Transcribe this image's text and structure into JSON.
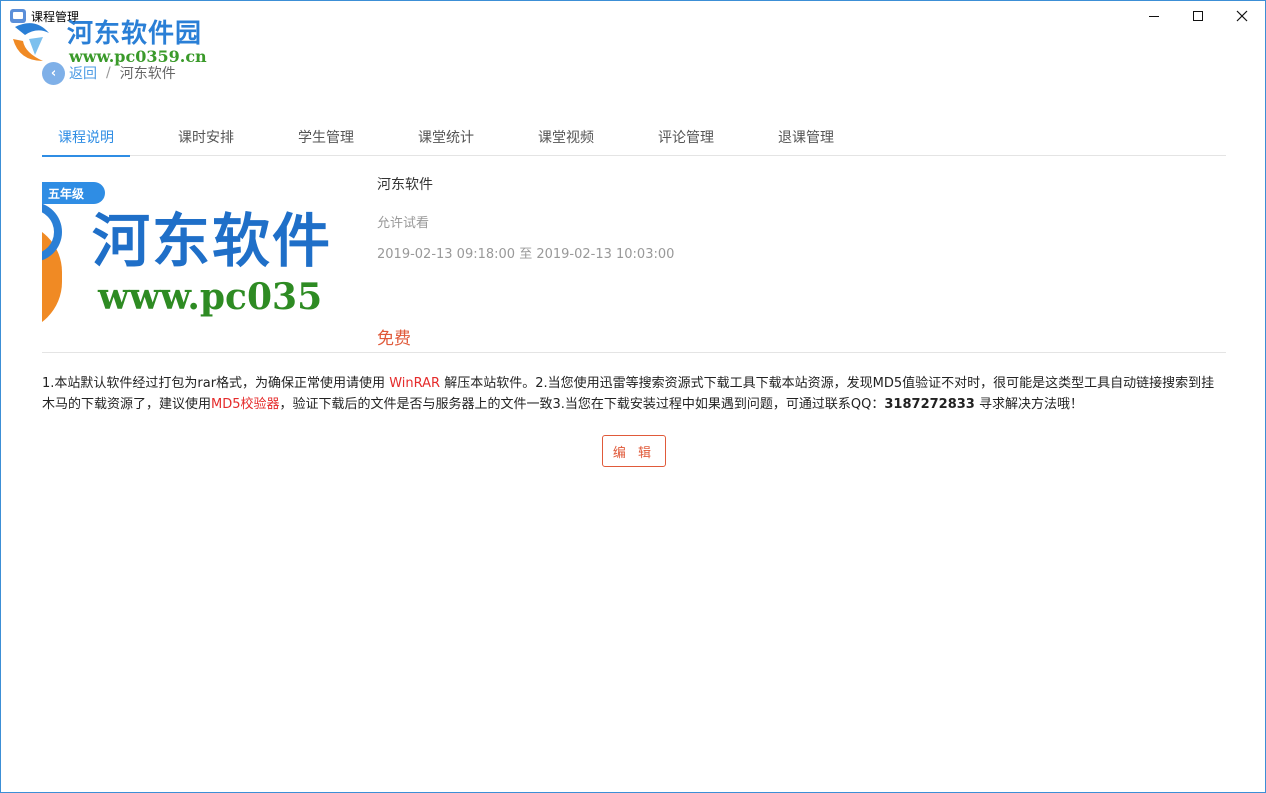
{
  "window": {
    "title": "课程管理",
    "controls": {
      "minimize_icon": "minimize-icon",
      "maximize_icon": "maximize-icon",
      "close_icon": "close-icon"
    }
  },
  "watermark": {
    "name": "河东软件园",
    "url": "www.pc0359.cn"
  },
  "breadcrumb": {
    "back_label": "返回",
    "separator": "/",
    "current": "河东软件"
  },
  "tabs": [
    {
      "label": "课程说明",
      "active": true
    },
    {
      "label": "课时安排",
      "active": false
    },
    {
      "label": "学生管理",
      "active": false
    },
    {
      "label": "课堂统计",
      "active": false
    },
    {
      "label": "课堂视频",
      "active": false
    },
    {
      "label": "评论管理",
      "active": false
    },
    {
      "label": "退课管理",
      "active": false
    }
  ],
  "course": {
    "grade_badge": "五年级",
    "cover_text": "河东软件",
    "cover_url": "www.pc035",
    "name": "河东软件",
    "trial": "允许试看",
    "time_range": "2019-02-13 09:18:00 至 2019-02-13 10:03:00",
    "price": "免费"
  },
  "description": {
    "part1": "1.本站默认软件经过打包为rar格式，为确保正常使用请使用 ",
    "winrar": "WinRAR",
    "part2": " 解压本站软件。2.当您使用迅雷等搜索资源式下载工具下载本站资源，发现MD5值验证不对时，很可能是这类型工具自动链接搜索到挂木马的下载资源了，建议使用",
    "md5tool": "MD5校验器",
    "part3": "，验证下载后的文件是否与服务器上的文件一致3.当您在下载安装过程中如果遇到问题，可通过联系QQ：",
    "qq": "3187272833",
    "part4": " 寻求解决方法哦！"
  },
  "actions": {
    "edit_label": "编 辑"
  },
  "colors": {
    "accent": "#2f8de4",
    "price": "#e05a3a",
    "link_red": "#e52b2b",
    "border": "#3c8fd6"
  }
}
